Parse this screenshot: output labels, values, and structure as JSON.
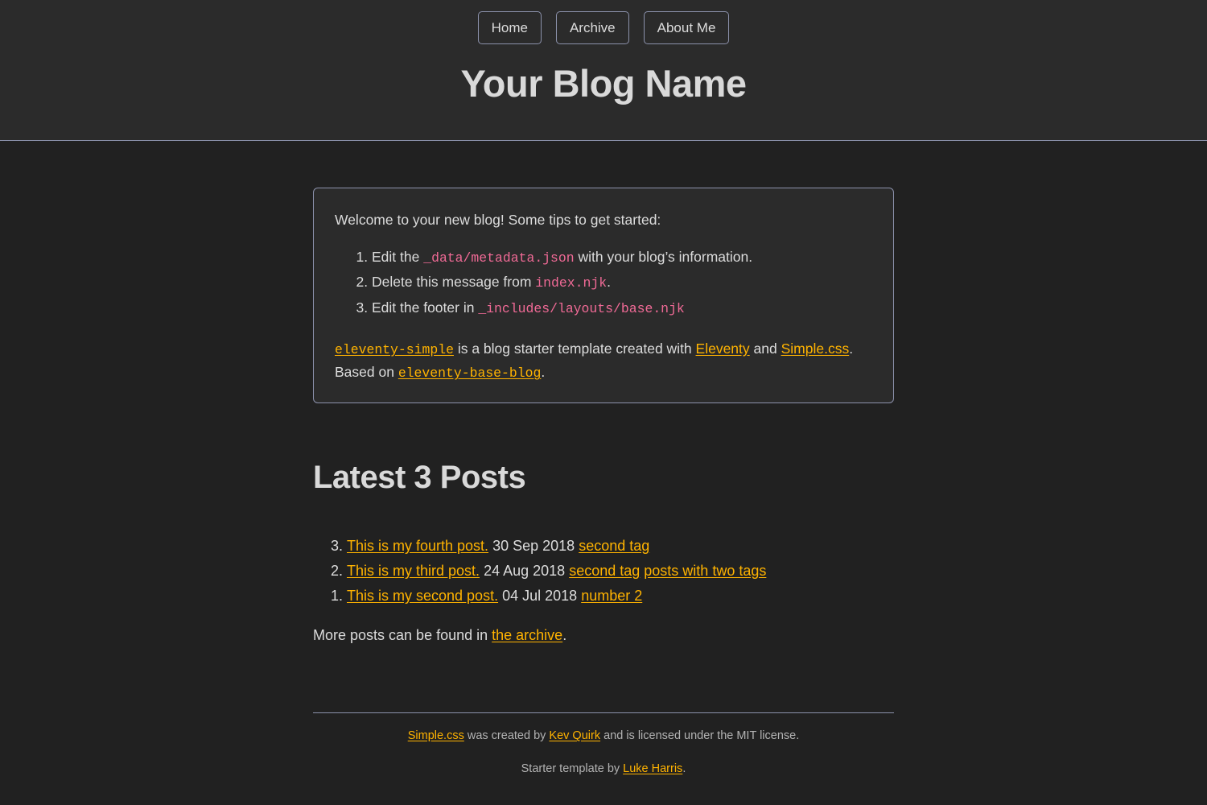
{
  "header": {
    "nav": [
      {
        "label": "Home",
        "name": "nav-home"
      },
      {
        "label": "Archive",
        "name": "nav-archive"
      },
      {
        "label": "About Me",
        "name": "nav-about-me"
      }
    ],
    "title": "Your Blog Name"
  },
  "welcome": {
    "intro": "Welcome to your new blog! Some tips to get started:",
    "tips": [
      {
        "before": "Edit the ",
        "code": "_data/metadata.json",
        "after": " with your blog’s information."
      },
      {
        "before": "Delete this message from ",
        "code": "index.njk",
        "after": "."
      },
      {
        "before": "Edit the footer in ",
        "code": "_includes/layouts/base.njk",
        "after": ""
      }
    ],
    "credits": {
      "link_template": "eleventy-simple",
      "text_1": " is a blog starter template created with ",
      "link_eleventy": "Eleventy",
      "text_2": " and ",
      "link_simplecss": "Simple.css",
      "text_3": ". Based on ",
      "link_base_blog": "eleventy-base-blog",
      "text_4": "."
    }
  },
  "posts_section": {
    "heading": "Latest 3 Posts",
    "items": [
      {
        "index": "3.",
        "title": "This is my fourth post.",
        "date": "30 Sep 2018",
        "tags": [
          "second tag"
        ]
      },
      {
        "index": "2.",
        "title": "This is my third post.",
        "date": "24 Aug 2018",
        "tags": [
          "second tag",
          "posts with two tags"
        ]
      },
      {
        "index": "1.",
        "title": "This is my second post.",
        "date": "04 Jul 2018",
        "tags": [
          "number 2"
        ]
      }
    ],
    "more_before": "More posts can be found in ",
    "more_link": "the archive",
    "more_after": "."
  },
  "footer": {
    "line1_link1": "Simple.css",
    "line1_text1": " was created by ",
    "line1_link2": "Kev Quirk",
    "line1_text2": " and is licensed under the MIT license.",
    "line2_text1": "Starter template by ",
    "line2_link": "Luke Harris",
    "line2_text2": "."
  },
  "colors": {
    "background": "#212121",
    "header_background": "#2b2b2b",
    "accent_link": "#ffb300",
    "code": "#f06a96",
    "border": "#8c92ac",
    "text": "#dcdcdc"
  }
}
